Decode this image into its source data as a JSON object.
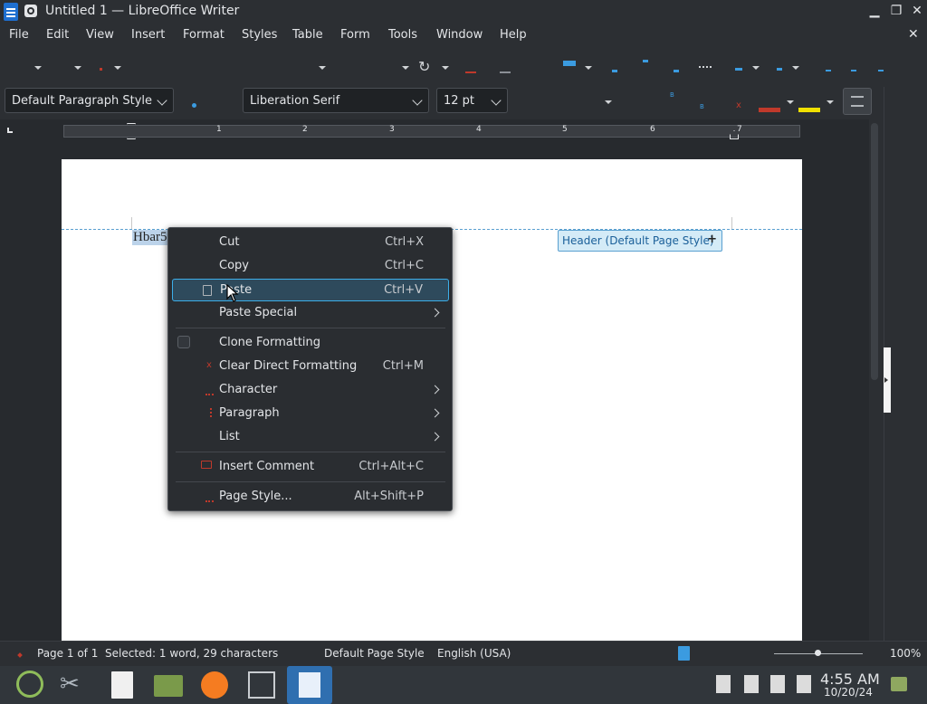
{
  "window": {
    "title": "Untitled 1 — LibreOffice Writer"
  },
  "menubar": [
    "File",
    "Edit",
    "View",
    "Insert",
    "Format",
    "Styles",
    "Table",
    "Form",
    "Tools",
    "Window",
    "Help"
  ],
  "formatting": {
    "paragraph_style": "Default Paragraph Style",
    "font_name": "Liberation Serif",
    "font_size": "12 pt"
  },
  "ruler": {
    "numbers": [
      "1",
      "2",
      "3",
      "4",
      "5",
      "6",
      "7"
    ]
  },
  "document": {
    "selected_text": "Hbar5",
    "header_tag": "Header (Default Page Style)",
    "header_tag_plus": "+"
  },
  "context_menu": {
    "items": [
      {
        "label": "Cut",
        "shortcut": "Ctrl+X"
      },
      {
        "label": "Copy",
        "shortcut": "Ctrl+C"
      },
      {
        "label": "Paste",
        "shortcut": "Ctrl+V"
      },
      {
        "label": "Paste Special",
        "shortcut": ""
      },
      {
        "label": "Clone Formatting",
        "shortcut": ""
      },
      {
        "label": "Clear Direct Formatting",
        "shortcut": "Ctrl+M"
      },
      {
        "label": "Character",
        "shortcut": ""
      },
      {
        "label": "Paragraph",
        "shortcut": ""
      },
      {
        "label": "List",
        "shortcut": ""
      },
      {
        "label": "Insert Comment",
        "shortcut": "Ctrl+Alt+C"
      },
      {
        "label": "Page Style...",
        "shortcut": "Alt+Shift+P"
      }
    ]
  },
  "statusbar": {
    "page": "Page 1 of 1",
    "selection": "Selected: 1 word, 29 characters",
    "page_style": "Default Page Style",
    "language": "English (USA)",
    "zoom": "100%"
  },
  "taskbar": {
    "time": "4:55 AM",
    "date": "10/20/24"
  },
  "colors": {
    "accent": "#3daee9",
    "font_color": "#c0392b",
    "highlight": "#f0e000"
  }
}
